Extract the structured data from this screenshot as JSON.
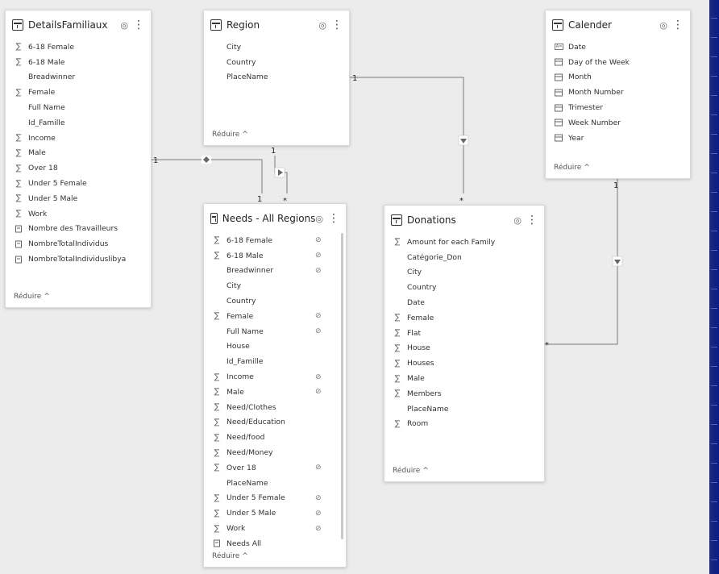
{
  "tables": {
    "details": {
      "title": "DetailsFamiliaux",
      "footer": "Réduire ^",
      "fields": [
        {
          "label": "6-18 Female",
          "icon": "sum"
        },
        {
          "label": "6-18 Male",
          "icon": "sum"
        },
        {
          "label": "Breadwinner",
          "icon": "none"
        },
        {
          "label": "Female",
          "icon": "sum"
        },
        {
          "label": "Full Name",
          "icon": "none"
        },
        {
          "label": "Id_Famille",
          "icon": "none"
        },
        {
          "label": "Income",
          "icon": "sum"
        },
        {
          "label": "Male",
          "icon": "sum"
        },
        {
          "label": "Over 18",
          "icon": "sum"
        },
        {
          "label": "Under 5 Female",
          "icon": "sum"
        },
        {
          "label": "Under 5 Male",
          "icon": "sum"
        },
        {
          "label": "Work",
          "icon": "sum"
        },
        {
          "label": "Nombre des Travailleurs",
          "icon": "measure"
        },
        {
          "label": "NombreTotalIndividus",
          "icon": "measure"
        },
        {
          "label": "NombreTotalIndividuslibya",
          "icon": "measure"
        }
      ]
    },
    "region": {
      "title": "Region",
      "footer": "Réduire ^",
      "fields": [
        {
          "label": "City",
          "icon": "none"
        },
        {
          "label": "Country",
          "icon": "none"
        },
        {
          "label": "PlaceName",
          "icon": "none"
        }
      ]
    },
    "calender": {
      "title": "Calender",
      "footer": "Réduire ^",
      "fields": [
        {
          "label": "Date",
          "icon": "text"
        },
        {
          "label": "Day of the Week",
          "icon": "calendar"
        },
        {
          "label": "Month",
          "icon": "calendar"
        },
        {
          "label": "Month Number",
          "icon": "calendar"
        },
        {
          "label": "Trimester",
          "icon": "calendar"
        },
        {
          "label": "Week Number",
          "icon": "calendar"
        },
        {
          "label": "Year",
          "icon": "calendar"
        }
      ]
    },
    "needs": {
      "title": "Needs - All Regions",
      "footer": "Réduire ^",
      "fields": [
        {
          "label": "6-18 Female",
          "icon": "sum",
          "hidden": true
        },
        {
          "label": "6-18 Male",
          "icon": "sum",
          "hidden": true
        },
        {
          "label": "Breadwinner",
          "icon": "none",
          "hidden": true
        },
        {
          "label": "City",
          "icon": "none"
        },
        {
          "label": "Country",
          "icon": "none"
        },
        {
          "label": "Female",
          "icon": "sum",
          "hidden": true
        },
        {
          "label": "Full Name",
          "icon": "none",
          "hidden": true
        },
        {
          "label": "House",
          "icon": "none"
        },
        {
          "label": "Id_Famille",
          "icon": "none"
        },
        {
          "label": "Income",
          "icon": "sum",
          "hidden": true
        },
        {
          "label": "Male",
          "icon": "sum",
          "hidden": true
        },
        {
          "label": "Need/Clothes",
          "icon": "sum"
        },
        {
          "label": "Need/Education",
          "icon": "sum"
        },
        {
          "label": "Need/food",
          "icon": "sum"
        },
        {
          "label": "Need/Money",
          "icon": "sum"
        },
        {
          "label": "Over 18",
          "icon": "sum",
          "hidden": true
        },
        {
          "label": "PlaceName",
          "icon": "none"
        },
        {
          "label": "Under 5 Female",
          "icon": "sum",
          "hidden": true
        },
        {
          "label": "Under 5 Male",
          "icon": "sum",
          "hidden": true
        },
        {
          "label": "Work",
          "icon": "sum",
          "hidden": true
        },
        {
          "label": "Needs All",
          "icon": "measure"
        }
      ]
    },
    "donations": {
      "title": "Donations",
      "footer": "Réduire ^",
      "fields": [
        {
          "label": "Amount for each Family",
          "icon": "sum"
        },
        {
          "label": "Catégorie_Don",
          "icon": "none"
        },
        {
          "label": "City",
          "icon": "none"
        },
        {
          "label": "Country",
          "icon": "none"
        },
        {
          "label": "Date",
          "icon": "none"
        },
        {
          "label": "Female",
          "icon": "sum"
        },
        {
          "label": "Flat",
          "icon": "sum"
        },
        {
          "label": "House",
          "icon": "sum"
        },
        {
          "label": "Houses",
          "icon": "sum"
        },
        {
          "label": "Male",
          "icon": "sum"
        },
        {
          "label": "Members",
          "icon": "sum"
        },
        {
          "label": "PlaceName",
          "icon": "none"
        },
        {
          "label": "Room",
          "icon": "sum"
        }
      ]
    }
  },
  "relationships": {
    "details_needs": {
      "one": "1",
      "many": "1"
    },
    "region_needs": {
      "one": "1",
      "many": "*"
    },
    "region_donations": {
      "one": "1",
      "many": "*"
    },
    "calender_donations": {
      "one": "1",
      "many": "*"
    }
  },
  "icons": {
    "sum": "sigma-icon",
    "measure": "measure-icon",
    "calendar": "calendar-icon",
    "text": "text-icon",
    "hidden": "hidden-eye-icon",
    "visible": "eye-icon",
    "more": "more-options-icon",
    "table": "table-icon"
  }
}
